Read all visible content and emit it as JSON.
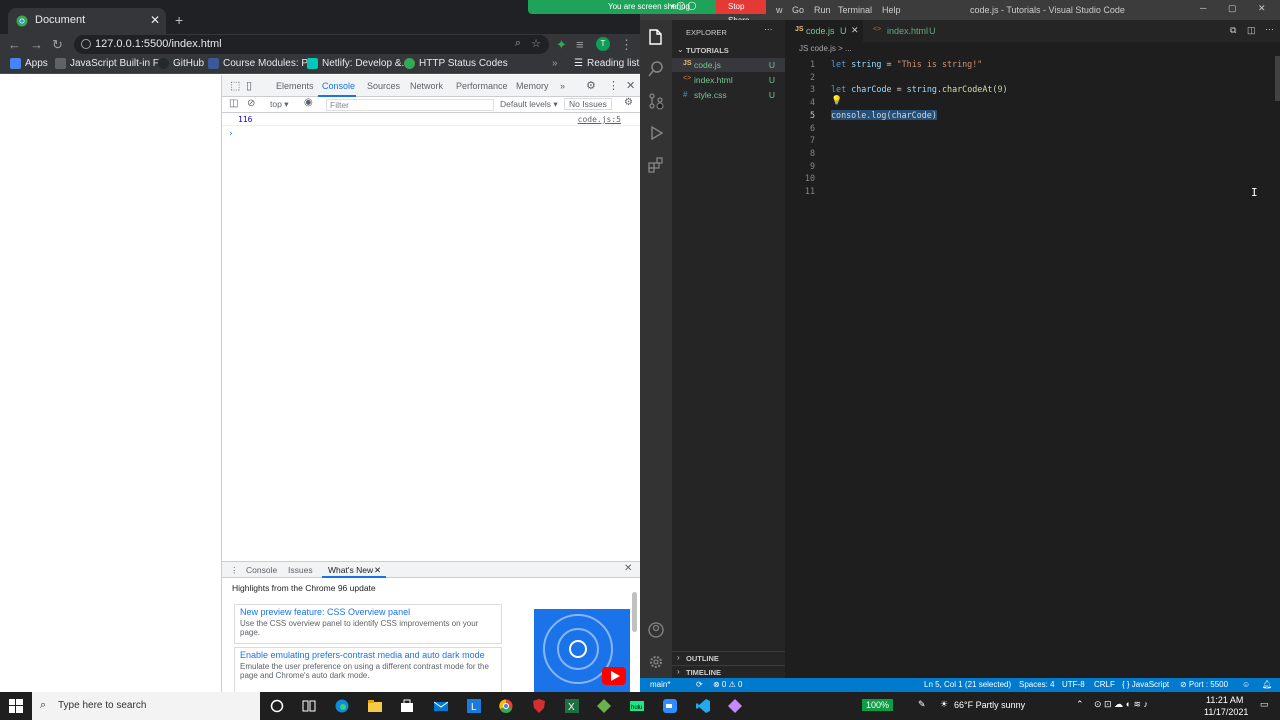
{
  "chrome": {
    "tab_title": "Document",
    "url": "127.0.0.1:5500/index.html",
    "avatar_initial": "T",
    "bookmarks": [
      {
        "label": "Apps",
        "color": "#4285f4"
      },
      {
        "label": "JavaScript Built-in F...",
        "color": "#5f6368"
      },
      {
        "label": "GitHub",
        "color": "#24292e"
      },
      {
        "label": "Course Modules: P...",
        "color": "#3b5998"
      },
      {
        "label": "Netlify: Develop &...",
        "color": "#00c7b7"
      },
      {
        "label": "HTTP Status Codes",
        "color": "#34a853"
      }
    ],
    "reading_list": "Reading list"
  },
  "devtools": {
    "tabs": [
      "Elements",
      "Console",
      "Sources",
      "Network",
      "Performance",
      "Memory"
    ],
    "context": "top",
    "filter_placeholder": "Filter",
    "levels": "Default levels",
    "issues": "No Issues",
    "console_output": [
      {
        "value": "116",
        "source": "code.js:5"
      }
    ],
    "drawer_tabs": [
      "Console",
      "Issues",
      "What's New"
    ],
    "drawer_title": "Highlights from the Chrome 96 update",
    "features": [
      {
        "title": "New preview feature: CSS Overview panel",
        "desc": "Use the CSS overview panel to identify CSS improvements on your page."
      },
      {
        "title": "Enable emulating prefers-contrast media and auto dark mode",
        "desc": "Emulate the user preference on using a different contrast mode for the page and Chrome's auto dark mode."
      }
    ]
  },
  "vscode": {
    "window_title": "code.js - Tutorials - Visual Studio Code",
    "menu": [
      "w",
      "Go",
      "Run",
      "Terminal",
      "Help"
    ],
    "share_text": "You are screen sharing",
    "stop_share": "Stop Share",
    "explorer_label": "EXPLORER",
    "folder": "TUTORIALS",
    "files": [
      {
        "name": "code.js",
        "badge": "U",
        "color": "#e5c07b"
      },
      {
        "name": "index.html",
        "badge": "U",
        "color": "#e37933"
      },
      {
        "name": "style.css",
        "badge": "U",
        "color": "#519aba"
      }
    ],
    "editor_tabs": [
      {
        "name": "code.js",
        "badge": "U"
      },
      {
        "name": "index.html",
        "badge": "U"
      }
    ],
    "breadcrumb": "JS code.js > ...",
    "line_numbers": [
      "1",
      "2",
      "3",
      "4",
      "5",
      "6",
      "7",
      "8",
      "9",
      "10",
      "11"
    ],
    "code": {
      "l1_kw": "let",
      "l1_var": "string",
      "l1_eq": " = ",
      "l1_str": "\"This is string!\"",
      "l3_kw": "let",
      "l3_var": "charCode",
      "l3_eq": " = ",
      "l3_obj": "string",
      "l3_dot": ".",
      "l3_fn": "charCodeAt",
      "l3_open": "(",
      "l3_num": "9",
      "l3_close": ")",
      "l5": "console.log(charCode)"
    },
    "outline": "OUTLINE",
    "timeline": "TIMELINE",
    "status": {
      "branch": "main*",
      "errors": "⊗ 0 ⚠ 0",
      "position": "Ln 5, Col 1 (21 selected)",
      "spaces": "Spaces: 4",
      "encoding": "UTF-8",
      "eol": "CRLF",
      "language": "{ } JavaScript",
      "port": "⊘ Port : 5500"
    }
  },
  "taskbar": {
    "search_placeholder": "Type here to search",
    "zoom": "100%",
    "weather": "66°F  Partly sunny",
    "time": "11:21 AM",
    "date": "11/17/2021"
  }
}
